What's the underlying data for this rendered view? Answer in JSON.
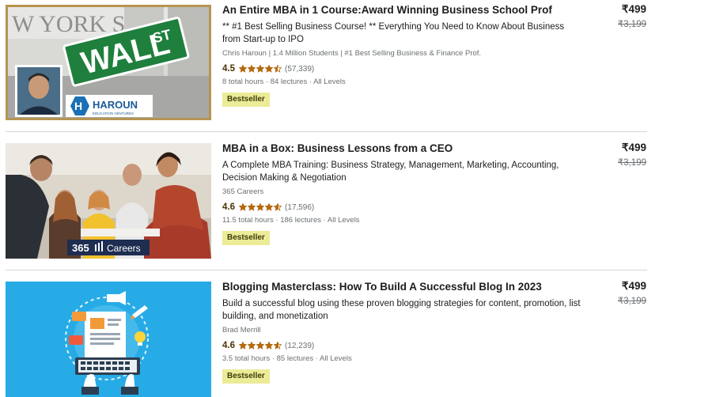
{
  "courses": [
    {
      "title": "An Entire MBA in 1 Course:Award Winning Business School Prof",
      "description": "** #1 Best Selling Business Course! ** Everything You Need to Know About Business from Start-up to IPO",
      "instructor": "Chris Haroun | 1.4 Million Students | #1 Best Selling Business & Finance Prof.",
      "rating": "4.5",
      "rating_value": 4.5,
      "reviews": "(57,339)",
      "meta": "8 total hours · 84 lectures · All Levels",
      "badge": "Bestseller",
      "price": "₹499",
      "original_price": "₹3,199",
      "thumb_text": {
        "sign": "WALL",
        "sign_st": "ST",
        "brand": "HAROUN",
        "brand_sub": "EDUCATION VENTURES",
        "wall_text": "W YORK STO"
      }
    },
    {
      "title": "MBA in a Box: Business Lessons from a CEO",
      "description": "A Complete MBA Training: Business Strategy, Management, Marketing, Accounting, Decision Making & Negotiation",
      "instructor": "365 Careers",
      "rating": "4.6",
      "rating_value": 4.6,
      "reviews": "(17,596)",
      "meta": "11.5 total hours · 186 lectures · All Levels",
      "badge": "Bestseller",
      "price": "₹499",
      "original_price": "₹3,199",
      "thumb_text": {
        "brand": "365",
        "brand_name": "Careers"
      }
    },
    {
      "title": "Blogging Masterclass: How To Build A Successful Blog In 2023",
      "description": "Build a successful blog using these proven blogging strategies for content, promotion, list building, and monetization",
      "instructor": "Brad Merrill",
      "rating": "4.6",
      "rating_value": 4.6,
      "reviews": "(12,239)",
      "meta": "3.5 total hours · 85 lectures · All Levels",
      "badge": "Bestseller",
      "price": "₹499",
      "original_price": "₹3,199"
    }
  ],
  "colors": {
    "star": "#b4690e",
    "rating_text": "#4d3105",
    "badge_bg": "#eceb98",
    "badge_text": "#3d3c0a",
    "muted": "#6a6f73"
  }
}
